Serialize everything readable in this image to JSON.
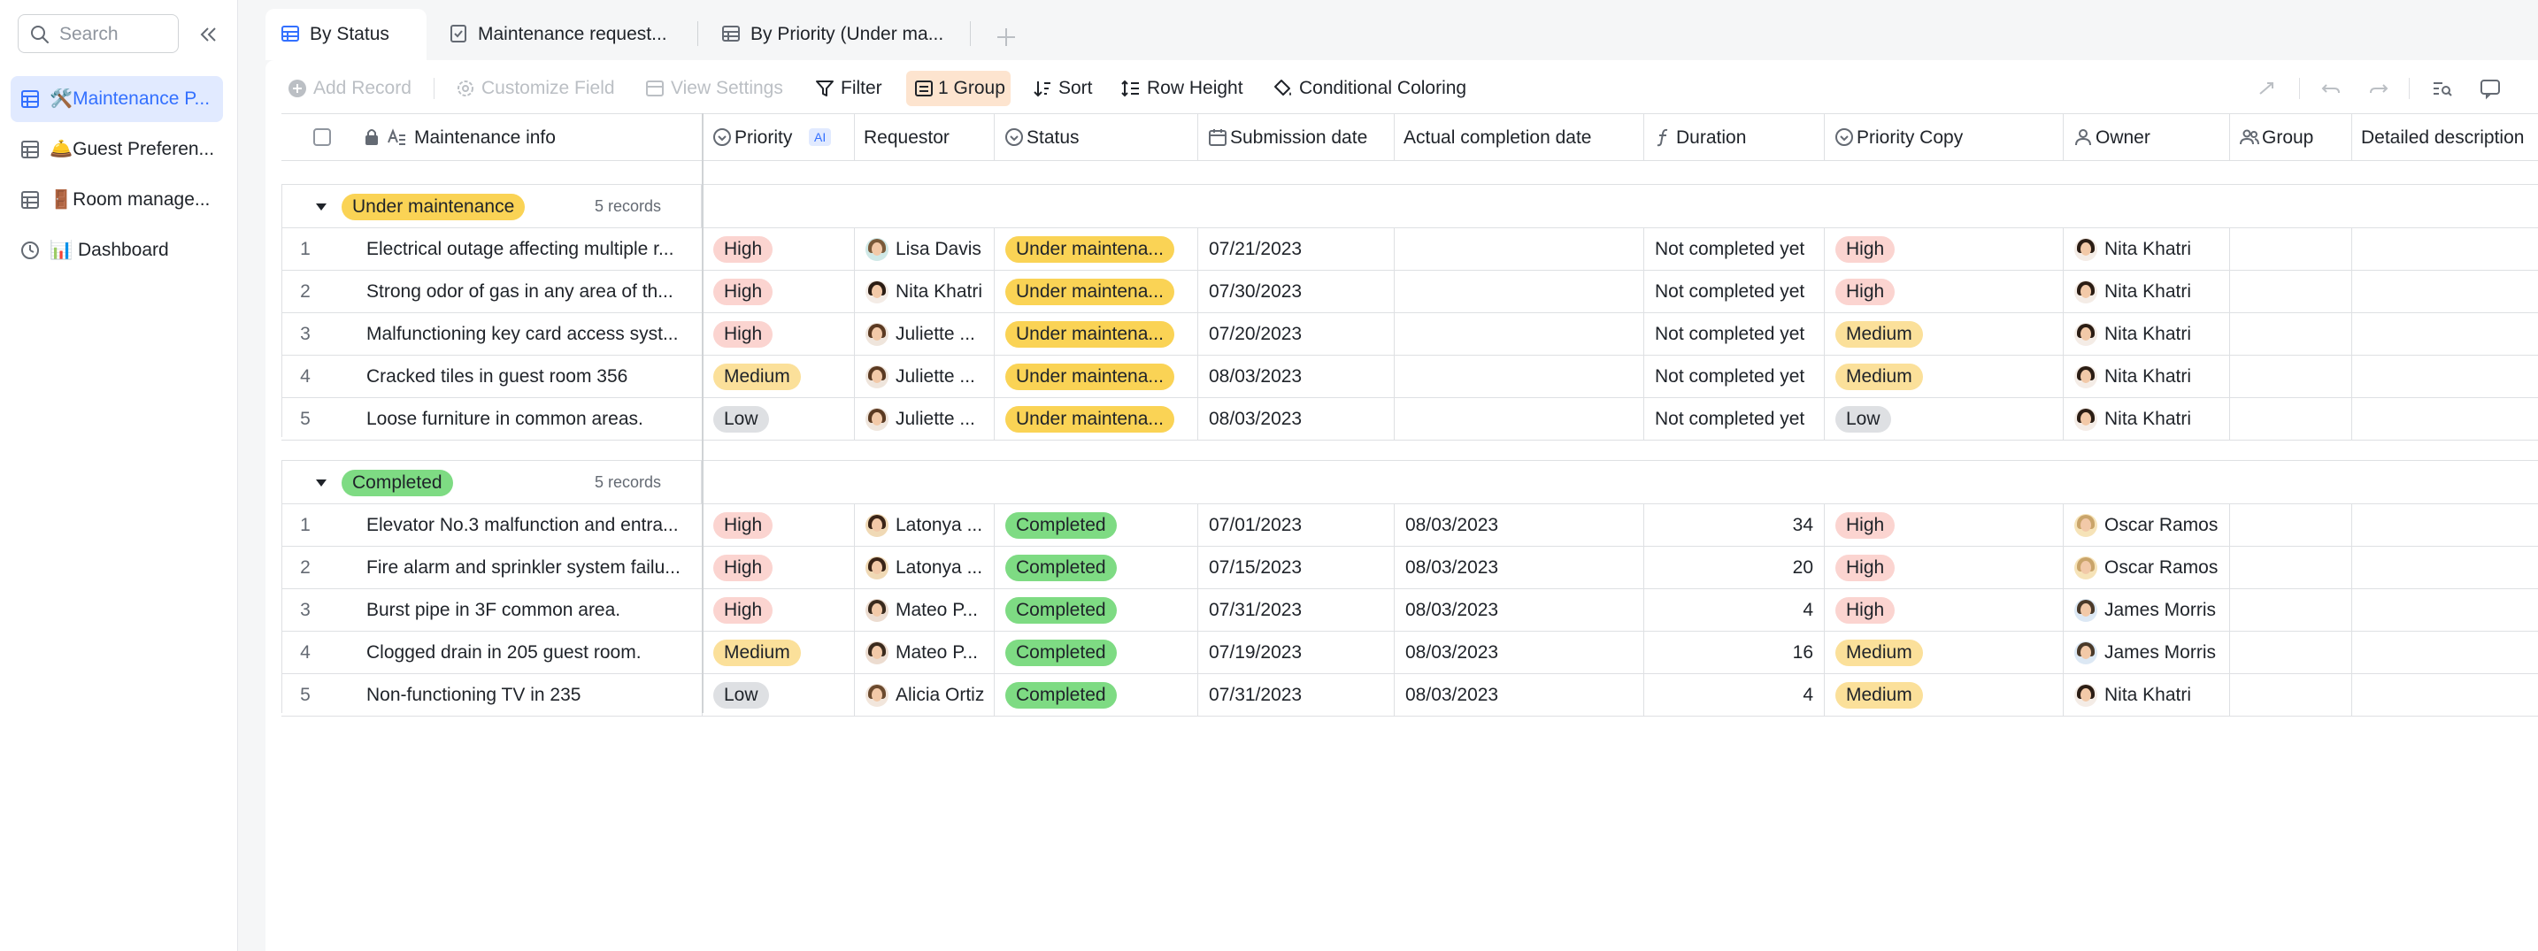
{
  "sidebar": {
    "search_placeholder": "Search",
    "items": [
      {
        "label": "🛠️Maintenance P...",
        "active": true,
        "icon": "table-icon"
      },
      {
        "label": "🛎️Guest Preferen...",
        "active": false,
        "icon": "table-icon"
      },
      {
        "label": "🚪Room manage...",
        "active": false,
        "icon": "table-icon"
      },
      {
        "label": "📊 Dashboard",
        "active": false,
        "icon": "dashboard-icon"
      }
    ]
  },
  "tabs": [
    {
      "label": "By Status",
      "active": true,
      "icon": "grid-view-icon"
    },
    {
      "label": "Maintenance request...",
      "active": false,
      "icon": "form-view-icon"
    },
    {
      "label": "By Priority (Under ma...",
      "active": false,
      "icon": "grid-view-icon"
    }
  ],
  "toolbar": {
    "add_record": "Add Record",
    "customize_field": "Customize Field",
    "view_settings": "View Settings",
    "filter": "Filter",
    "group": "1 Group",
    "sort": "Sort",
    "row_height": "Row Height",
    "conditional_coloring": "Conditional Coloring"
  },
  "columns": {
    "info": "Maintenance info",
    "priority": "Priority",
    "ai_badge": "AI",
    "requestor": "Requestor",
    "status": "Status",
    "submission": "Submission date",
    "actual": "Actual completion date",
    "duration": "Duration",
    "priority_copy": "Priority Copy",
    "owner": "Owner",
    "group": "Group",
    "detailed": "Detailed description"
  },
  "colors": {
    "accent": "#3370ff",
    "high": "#fbd4d0",
    "medium": "#fbe09a",
    "low": "#dee0e3",
    "under_maintenance": "#fad355",
    "completed": "#7edb83"
  },
  "groups": [
    {
      "label": "Under maintenance",
      "count": "5 records",
      "rows": [
        {
          "n": "1",
          "info": "Electrical outage affecting multiple r...",
          "priority": "High",
          "requestor": "Lisa Davis",
          "status": "Under maintena...",
          "submission": "07/21/2023",
          "actual": "",
          "duration": "Not completed yet",
          "priority_copy": "High",
          "owner": "Nita Khatri"
        },
        {
          "n": "2",
          "info": "Strong odor of gas in any area of th...",
          "priority": "High",
          "requestor": "Nita Khatri",
          "status": "Under maintena...",
          "submission": "07/30/2023",
          "actual": "",
          "duration": "Not completed yet",
          "priority_copy": "High",
          "owner": "Nita Khatri"
        },
        {
          "n": "3",
          "info": "Malfunctioning key card access syst...",
          "priority": "High",
          "requestor": "Juliette ...",
          "status": "Under maintena...",
          "submission": "07/20/2023",
          "actual": "",
          "duration": "Not completed yet",
          "priority_copy": "Medium",
          "owner": "Nita Khatri"
        },
        {
          "n": "4",
          "info": "Cracked tiles in guest room 356",
          "priority": "Medium",
          "requestor": "Juliette ...",
          "status": "Under maintena...",
          "submission": "08/03/2023",
          "actual": "",
          "duration": "Not completed yet",
          "priority_copy": "Medium",
          "owner": "Nita Khatri"
        },
        {
          "n": "5",
          "info": "Loose furniture in common areas.",
          "priority": "Low",
          "requestor": "Juliette ...",
          "status": "Under maintena...",
          "submission": "08/03/2023",
          "actual": "",
          "duration": "Not completed yet",
          "priority_copy": "Low",
          "owner": "Nita Khatri"
        }
      ]
    },
    {
      "label": "Completed",
      "count": "5 records",
      "rows": [
        {
          "n": "1",
          "info": "Elevator No.3 malfunction and entra...",
          "priority": "High",
          "requestor": "Latonya ...",
          "status": "Completed",
          "submission": "07/01/2023",
          "actual": "08/03/2023",
          "duration": "34",
          "priority_copy": "High",
          "owner": "Oscar Ramos"
        },
        {
          "n": "2",
          "info": "Fire alarm and sprinkler system failu...",
          "priority": "High",
          "requestor": "Latonya ...",
          "status": "Completed",
          "submission": "07/15/2023",
          "actual": "08/03/2023",
          "duration": "20",
          "priority_copy": "High",
          "owner": "Oscar Ramos"
        },
        {
          "n": "3",
          "info": "Burst pipe in 3F common area.",
          "priority": "High",
          "requestor": "Mateo P...",
          "status": "Completed",
          "submission": "07/31/2023",
          "actual": "08/03/2023",
          "duration": "4",
          "priority_copy": "High",
          "owner": "James Morris"
        },
        {
          "n": "4",
          "info": "Clogged drain in 205 guest room.",
          "priority": "Medium",
          "requestor": "Mateo P...",
          "status": "Completed",
          "submission": "07/19/2023",
          "actual": "08/03/2023",
          "duration": "16",
          "priority_copy": "Medium",
          "owner": "James Morris"
        },
        {
          "n": "5",
          "info": "Non-functioning TV in 235",
          "priority": "Low",
          "requestor": "Alicia Ortiz",
          "status": "Completed",
          "submission": "07/31/2023",
          "actual": "08/03/2023",
          "duration": "4",
          "priority_copy": "Medium",
          "owner": "Nita Khatri"
        }
      ]
    }
  ]
}
